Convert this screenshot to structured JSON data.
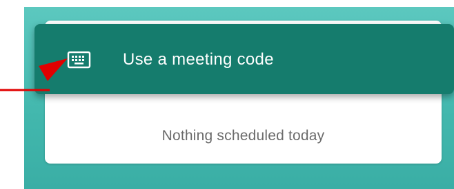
{
  "menu": {
    "use_code_label": "Use a meeting code",
    "icon": "keyboard-icon"
  },
  "schedule": {
    "empty_text": "Nothing scheduled today"
  },
  "colors": {
    "background_teal": "#42b7ad",
    "menu_bg": "#157c6d",
    "annotation_red": "#e10000"
  }
}
